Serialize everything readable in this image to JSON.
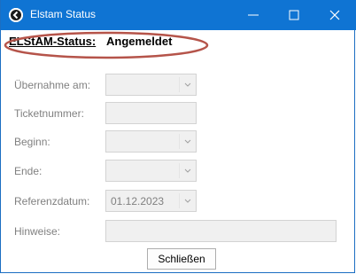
{
  "window": {
    "title": "Elstam Status"
  },
  "status": {
    "label": "ELStAM-Status:",
    "value": "Angemeldet"
  },
  "form": {
    "uebernahme_label": "Übernahme am:",
    "uebernahme_value": "",
    "ticket_label": "Ticketnummer:",
    "ticket_value": "",
    "beginn_label": "Beginn:",
    "beginn_value": "",
    "ende_label": "Ende:",
    "ende_value": "",
    "referenz_label": "Referenzdatum:",
    "referenz_value": "01.12.2023",
    "hinweise_label": "Hinweise:",
    "hinweise_value": ""
  },
  "buttons": {
    "close_label": "Schließen"
  },
  "colors": {
    "titlebar": "#0f74d3",
    "highlight_ellipse": "#b5544a"
  }
}
